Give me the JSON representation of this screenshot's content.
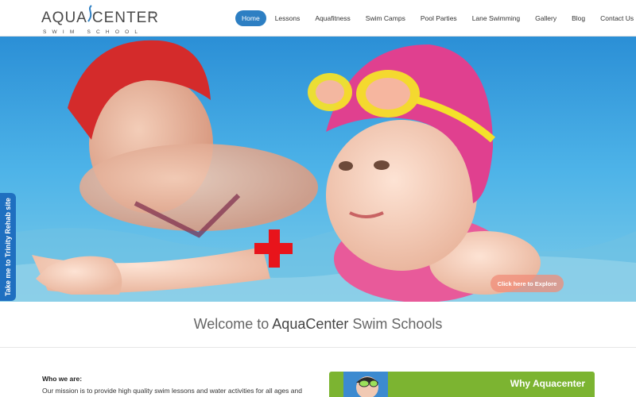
{
  "brand": {
    "name_part1": "AQUA",
    "name_part2": "CENTER",
    "trademark": "™",
    "subtitle": "SWIM SCHOOL"
  },
  "nav": {
    "items": [
      {
        "label": "Home",
        "active": true
      },
      {
        "label": "Lessons",
        "active": false
      },
      {
        "label": "Aquafitness",
        "active": false
      },
      {
        "label": "Swim Camps",
        "active": false
      },
      {
        "label": "Pool Parties",
        "active": false
      },
      {
        "label": "Lane Swimming",
        "active": false
      },
      {
        "label": "Gallery",
        "active": false
      },
      {
        "label": "Blog",
        "active": false
      },
      {
        "label": "Contact Us",
        "active": false
      }
    ]
  },
  "hero": {
    "cta_label": "Click here to Explore",
    "side_tab_label": "Take me to Trinity Rehab site"
  },
  "welcome": {
    "prefix": "Welcome to ",
    "brand": "AquaCenter",
    "suffix": " Swim Schools"
  },
  "about": {
    "heading": "Who we are:",
    "text": "Our mission is to provide high quality swim lessons and water activities for all ages and swimming"
  },
  "why": {
    "title": "Why Aquacenter"
  },
  "colors": {
    "nav_active": "#2d7fc3",
    "side_tab": "#1f6fc0",
    "why_banner": "#7cb431",
    "cross": "#e8141b"
  }
}
